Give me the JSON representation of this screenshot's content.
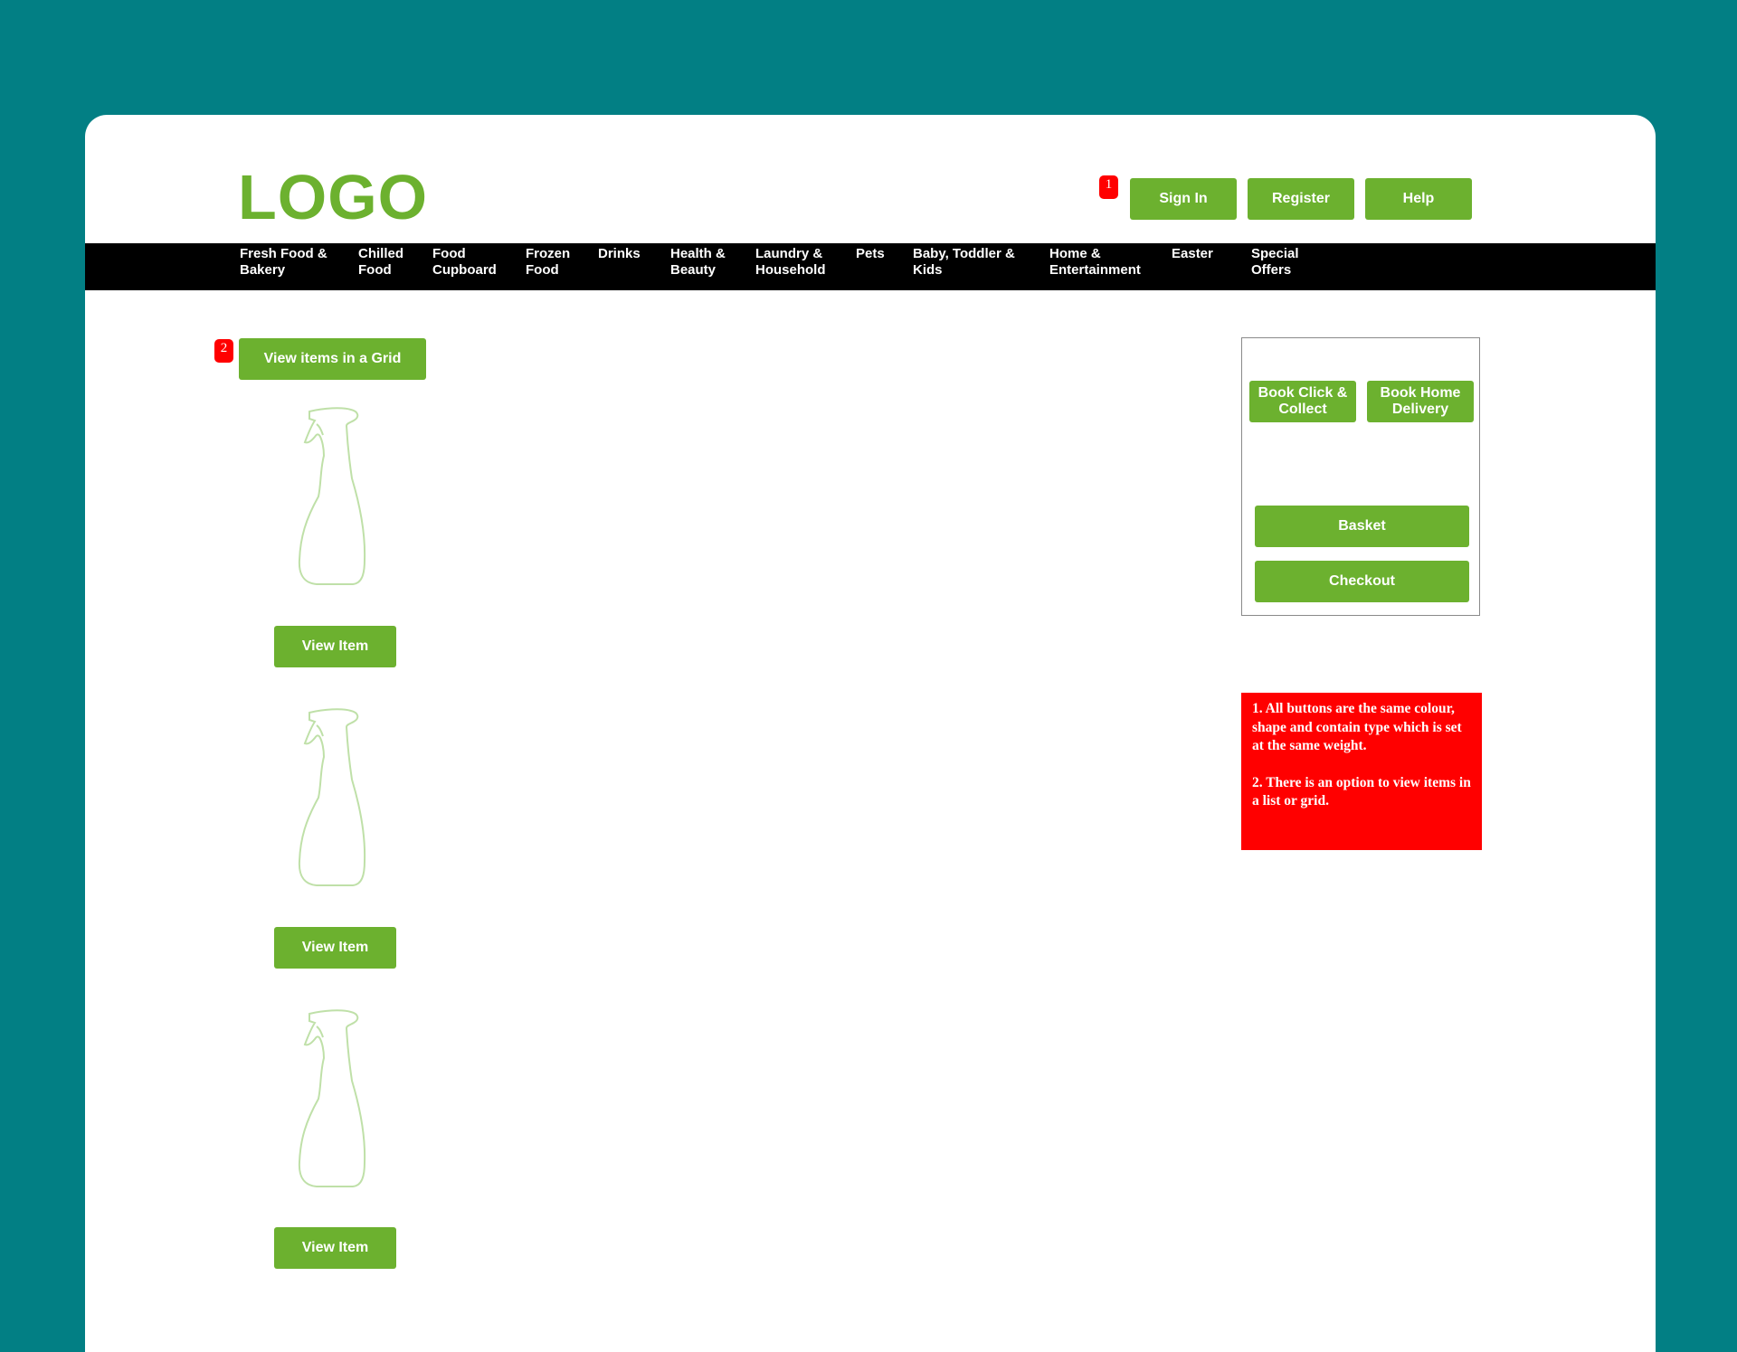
{
  "header": {
    "logo": "LOGO",
    "annotation_1": "1",
    "sign_in": "Sign In",
    "register": "Register",
    "help": "Help"
  },
  "nav": {
    "items": [
      {
        "label": "Fresh Food &\nBakery"
      },
      {
        "label": "Chilled\nFood"
      },
      {
        "label": "Food\nCupboard"
      },
      {
        "label": "Frozen\nFood"
      },
      {
        "label": "Drinks"
      },
      {
        "label": "Health &\nBeauty"
      },
      {
        "label": "Laundry &\nHousehold"
      },
      {
        "label": "Pets"
      },
      {
        "label": "Baby, Toddler &\nKids"
      },
      {
        "label": "Home &\nEntertainment"
      },
      {
        "label": "Easter"
      },
      {
        "label": "Special\nOffers"
      }
    ]
  },
  "main": {
    "annotation_2": "2",
    "view_grid": "View items in a Grid",
    "products": [
      {
        "image": "spray-bottle-icon",
        "button": "View Item"
      },
      {
        "image": "spray-bottle-icon",
        "button": "View Item"
      },
      {
        "image": "spray-bottle-icon",
        "button": "View Item"
      }
    ]
  },
  "sidebar": {
    "book_click_collect": "Book Click &\nCollect",
    "book_home_delivery": "Book Home\nDelivery",
    "basket": "Basket",
    "checkout": "Checkout"
  },
  "note": {
    "line1": "1. All buttons are the same colour, shape and contain type which is set at the same weight.",
    "line2": "2. There is an option to view items in a list or grid."
  },
  "colors": {
    "background": "#027f84",
    "accent": "#6cb12f",
    "annotation": "#ff0000",
    "nav": "#000000"
  }
}
